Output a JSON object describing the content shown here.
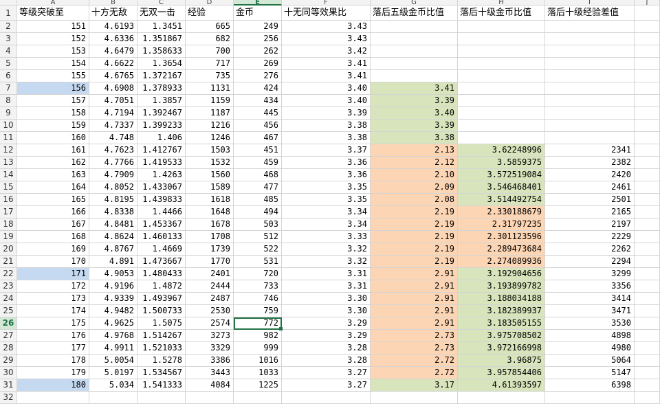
{
  "spreadsheet": {
    "column_letters": [
      "A",
      "B",
      "C",
      "D",
      "E",
      "F",
      "G",
      "H",
      "I",
      "J"
    ],
    "selected_column": "E",
    "selected_row": 26,
    "headers": [
      "等级突破至",
      "十方无敌",
      "无双一击",
      "经验",
      "金币",
      "十无同等效果比",
      "落后五级金币比值",
      "落后十级金币比值",
      "落后十级经验差值",
      ""
    ],
    "rows": [
      {
        "n": "2",
        "c": [
          "151",
          "4.6193",
          "1.3451",
          "665",
          "249",
          "3.43",
          "",
          "",
          ""
        ]
      },
      {
        "n": "3",
        "c": [
          "152",
          "4.6336",
          "1.351867",
          "682",
          "256",
          "3.43",
          "",
          "",
          ""
        ]
      },
      {
        "n": "4",
        "c": [
          "153",
          "4.6479",
          "1.358633",
          "700",
          "262",
          "3.42",
          "",
          "",
          ""
        ]
      },
      {
        "n": "5",
        "c": [
          "154",
          "4.6622",
          "1.3654",
          "717",
          "269",
          "3.41",
          "",
          "",
          ""
        ]
      },
      {
        "n": "6",
        "c": [
          "155",
          "4.6765",
          "1.372167",
          "735",
          "276",
          "3.41",
          "",
          "",
          ""
        ]
      },
      {
        "n": "7",
        "c": [
          "156",
          "4.6908",
          "1.378933",
          "1131",
          "424",
          "3.40",
          "3.41",
          "",
          ""
        ]
      },
      {
        "n": "8",
        "c": [
          "157",
          "4.7051",
          "1.3857",
          "1159",
          "434",
          "3.40",
          "3.39",
          "",
          ""
        ]
      },
      {
        "n": "9",
        "c": [
          "158",
          "4.7194",
          "1.392467",
          "1187",
          "445",
          "3.39",
          "3.40",
          "",
          ""
        ]
      },
      {
        "n": "10",
        "c": [
          "159",
          "4.7337",
          "1.399233",
          "1216",
          "456",
          "3.38",
          "3.39",
          "",
          ""
        ]
      },
      {
        "n": "11",
        "c": [
          "160",
          "4.748",
          "1.406",
          "1246",
          "467",
          "3.38",
          "3.38",
          "",
          ""
        ]
      },
      {
        "n": "12",
        "c": [
          "161",
          "4.7623",
          "1.412767",
          "1503",
          "451",
          "3.37",
          "2.13",
          "3.62248996",
          "2341"
        ]
      },
      {
        "n": "13",
        "c": [
          "162",
          "4.7766",
          "1.419533",
          "1532",
          "459",
          "3.36",
          "2.12",
          "3.5859375",
          "2382"
        ]
      },
      {
        "n": "14",
        "c": [
          "163",
          "4.7909",
          "1.4263",
          "1560",
          "468",
          "3.36",
          "2.10",
          "3.572519084",
          "2420"
        ]
      },
      {
        "n": "15",
        "c": [
          "164",
          "4.8052",
          "1.433067",
          "1589",
          "477",
          "3.35",
          "2.09",
          "3.546468401",
          "2461"
        ]
      },
      {
        "n": "16",
        "c": [
          "165",
          "4.8195",
          "1.439833",
          "1618",
          "485",
          "3.35",
          "2.08",
          "3.514492754",
          "2501"
        ]
      },
      {
        "n": "17",
        "c": [
          "166",
          "4.8338",
          "1.4466",
          "1648",
          "494",
          "3.34",
          "2.19",
          "2.330188679",
          "2165"
        ]
      },
      {
        "n": "18",
        "c": [
          "167",
          "4.8481",
          "1.453367",
          "1678",
          "503",
          "3.34",
          "2.19",
          "2.31797235",
          "2197"
        ]
      },
      {
        "n": "19",
        "c": [
          "168",
          "4.8624",
          "1.460133",
          "1708",
          "512",
          "3.33",
          "2.19",
          "2.301123596",
          "2229"
        ]
      },
      {
        "n": "20",
        "c": [
          "169",
          "4.8767",
          "1.4669",
          "1739",
          "522",
          "3.32",
          "2.19",
          "2.289473684",
          "2262"
        ]
      },
      {
        "n": "21",
        "c": [
          "170",
          "4.891",
          "1.473667",
          "1770",
          "531",
          "3.32",
          "2.19",
          "2.274089936",
          "2294"
        ]
      },
      {
        "n": "22",
        "c": [
          "171",
          "4.9053",
          "1.480433",
          "2401",
          "720",
          "3.31",
          "2.91",
          "3.192904656",
          "3299"
        ]
      },
      {
        "n": "23",
        "c": [
          "172",
          "4.9196",
          "1.4872",
          "2444",
          "733",
          "3.31",
          "2.91",
          "3.193899782",
          "3356"
        ]
      },
      {
        "n": "24",
        "c": [
          "173",
          "4.9339",
          "1.493967",
          "2487",
          "746",
          "3.30",
          "2.91",
          "3.188034188",
          "3414"
        ]
      },
      {
        "n": "25",
        "c": [
          "174",
          "4.9482",
          "1.500733",
          "2530",
          "759",
          "3.30",
          "2.91",
          "3.182389937",
          "3471"
        ]
      },
      {
        "n": "26",
        "c": [
          "175",
          "4.9625",
          "1.5075",
          "2574",
          "772",
          "3.29",
          "2.91",
          "3.183505155",
          "3530"
        ]
      },
      {
        "n": "27",
        "c": [
          "176",
          "4.9768",
          "1.514267",
          "3273",
          "982",
          "3.29",
          "2.73",
          "3.975708502",
          "4898"
        ]
      },
      {
        "n": "28",
        "c": [
          "177",
          "4.9911",
          "1.521033",
          "3329",
          "999",
          "3.28",
          "2.73",
          "3.972166998",
          "4980"
        ]
      },
      {
        "n": "29",
        "c": [
          "178",
          "5.0054",
          "1.5278",
          "3386",
          "1016",
          "3.28",
          "2.72",
          "3.96875",
          "5064"
        ]
      },
      {
        "n": "30",
        "c": [
          "179",
          "5.0197",
          "1.534567",
          "3443",
          "1033",
          "3.27",
          "2.72",
          "3.957854406",
          "5147"
        ]
      },
      {
        "n": "31",
        "c": [
          "180",
          "5.034",
          "1.541333",
          "4084",
          "1225",
          "3.27",
          "3.17",
          "4.61393597",
          "6398"
        ]
      },
      {
        "n": "32",
        "c": [
          "",
          "",
          "",
          "",
          "",
          "",
          "",
          "",
          ""
        ]
      }
    ],
    "fill_colors": {
      "green": "#d8e4bc",
      "orange": "#fcd5b4",
      "blue": "#c5d9f1",
      "selection": "#217346"
    }
  }
}
